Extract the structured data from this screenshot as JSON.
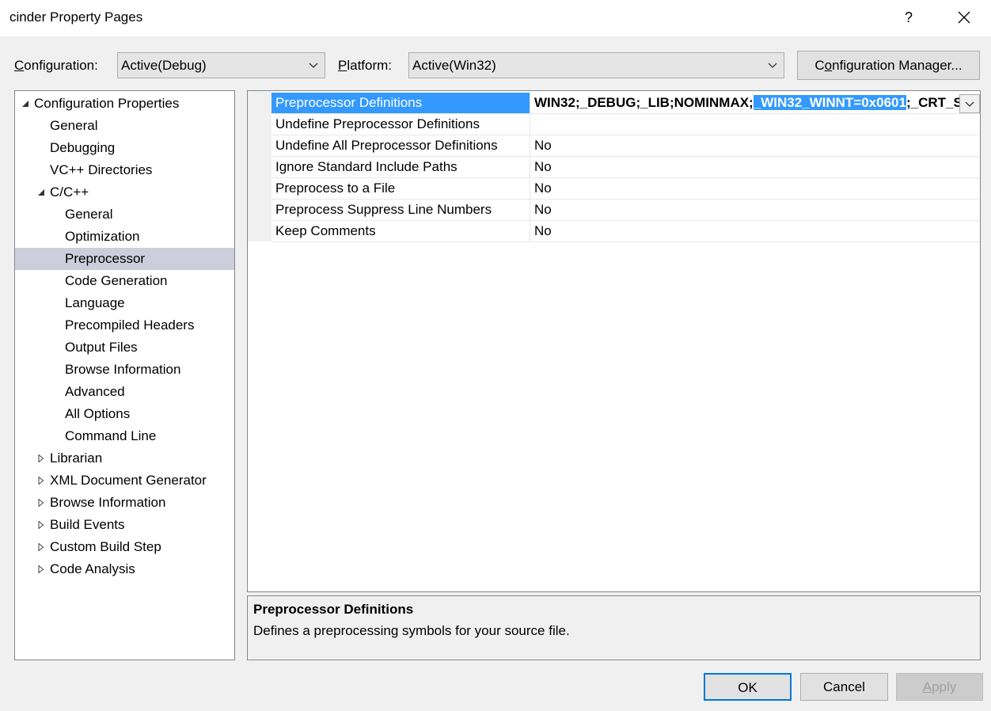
{
  "window": {
    "title": "cinder Property Pages",
    "help_label": "?",
    "close_icon": "close-icon"
  },
  "toolbar": {
    "configuration_label_accel": "C",
    "configuration_label_rest": "onfiguration:",
    "configuration_value": "Active(Debug)",
    "platform_label_accel": "P",
    "platform_label_rest": "latform:",
    "platform_value": "Active(Win32)",
    "config_manager_pre": "C",
    "config_manager_accel": "o",
    "config_manager_post": "nfiguration Manager..."
  },
  "tree": {
    "items": [
      {
        "label": "Configuration Properties",
        "expander": "expanded"
      },
      {
        "label": "General",
        "expander": "none"
      },
      {
        "label": "Debugging",
        "expander": "none"
      },
      {
        "label": "VC++ Directories",
        "expander": "none"
      },
      {
        "label": "C/C++",
        "expander": "expanded"
      },
      {
        "label": "General",
        "expander": "none"
      },
      {
        "label": "Optimization",
        "expander": "none"
      },
      {
        "label": "Preprocessor",
        "expander": "none",
        "selected": true
      },
      {
        "label": "Code Generation",
        "expander": "none"
      },
      {
        "label": "Language",
        "expander": "none"
      },
      {
        "label": "Precompiled Headers",
        "expander": "none"
      },
      {
        "label": "Output Files",
        "expander": "none"
      },
      {
        "label": "Browse Information",
        "expander": "none"
      },
      {
        "label": "Advanced",
        "expander": "none"
      },
      {
        "label": "All Options",
        "expander": "none"
      },
      {
        "label": "Command Line",
        "expander": "none"
      },
      {
        "label": "Librarian",
        "expander": "collapsed"
      },
      {
        "label": "XML Document Generator",
        "expander": "collapsed"
      },
      {
        "label": "Browse Information",
        "expander": "collapsed"
      },
      {
        "label": "Build Events",
        "expander": "collapsed"
      },
      {
        "label": "Custom Build Step",
        "expander": "collapsed"
      },
      {
        "label": "Code Analysis",
        "expander": "collapsed"
      }
    ]
  },
  "grid": {
    "rows": [
      {
        "name": "Preprocessor Definitions",
        "value": "",
        "selected": true
      },
      {
        "name": "Undefine Preprocessor Definitions",
        "value": ""
      },
      {
        "name": "Undefine All Preprocessor Definitions",
        "value": "No"
      },
      {
        "name": "Ignore Standard Include Paths",
        "value": "No"
      },
      {
        "name": "Preprocess to a File",
        "value": "No"
      },
      {
        "name": "Preprocess Suppress Line Numbers",
        "value": "No"
      },
      {
        "name": "Keep Comments",
        "value": "No"
      }
    ],
    "defs_before": "WIN32;_DEBUG;_LIB;NOMINMAX;",
    "defs_selected": "_WIN32_WINNT=0x0601",
    "defs_after": ";_CRT_SECURE_NO_WARNINGS"
  },
  "description": {
    "title": "Preprocessor Definitions",
    "text": "Defines a preprocessing symbols for your source file."
  },
  "buttons": {
    "ok": "OK",
    "cancel": "Cancel",
    "apply_accel": "A",
    "apply_rest": "pply"
  },
  "colors": {
    "selection": "#3399ff",
    "tree_selection": "#cccedb",
    "ok_border": "#0078d7"
  }
}
